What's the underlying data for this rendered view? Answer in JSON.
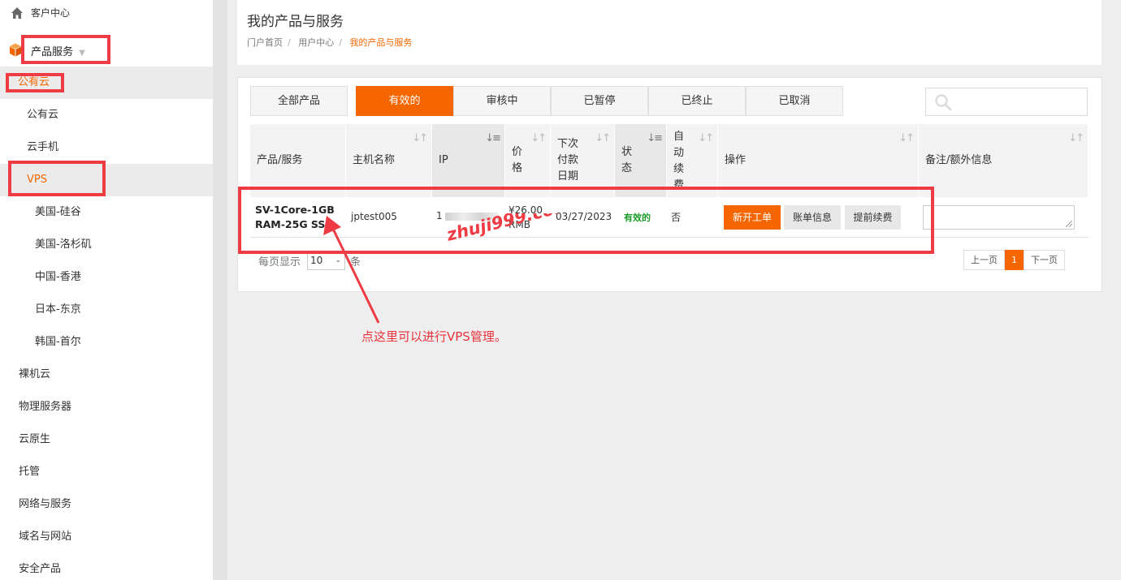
{
  "sidebar": {
    "header": "客户中心",
    "product_menu": "产品服务",
    "public_cloud_group": "公有云",
    "items": [
      {
        "label": "公有云"
      },
      {
        "label": "云手机"
      },
      {
        "label": "VPS"
      },
      {
        "label": "美国-硅谷"
      },
      {
        "label": "美国-洛杉矶"
      },
      {
        "label": "中国-香港"
      },
      {
        "label": "日本-东京"
      },
      {
        "label": "韩国-首尔"
      },
      {
        "label": "裸机云"
      },
      {
        "label": "物理服务器"
      },
      {
        "label": "云原生"
      },
      {
        "label": "托管"
      },
      {
        "label": "网络与服务"
      },
      {
        "label": "域名与网站"
      },
      {
        "label": "安全产品"
      }
    ]
  },
  "header": {
    "title": "我的产品与服务",
    "breadcrumb": [
      "门户首页",
      "用户中心",
      "我的产品与服务"
    ]
  },
  "tabs": [
    "全部产品",
    "有效的",
    "审核中",
    "已暂停",
    "已终止",
    "已取消"
  ],
  "table": {
    "columns": [
      "产品/服务",
      "主机名称",
      "IP",
      "价格",
      "下次付款日期",
      "状态",
      "自动续费",
      "操作",
      "备注/额外信息"
    ],
    "col_price_lines": [
      "价",
      "格"
    ],
    "col_due_lines": [
      "下次",
      "付款",
      "日期"
    ],
    "col_status_lines": [
      "状",
      "态"
    ],
    "col_renew_lines": [
      "自",
      "动",
      "续",
      "费"
    ],
    "row": {
      "product_line1": "SV-1Core-1GB",
      "product_line2": "RAM-25G SSD",
      "hostname": "jptest005",
      "ip": "1",
      "price_line1": "¥26.00",
      "price_line2": "RMB",
      "due_date": "03/27/2023",
      "status": "有效的",
      "auto_renew": "否",
      "actions": [
        "新开工单",
        "账单信息",
        "提前续费"
      ]
    }
  },
  "pager": {
    "per_page_prefix": "每页显示",
    "per_page_value": "10",
    "per_page_suffix": "条",
    "prev": "上一页",
    "current": "1",
    "next": "下一页"
  },
  "annotation": {
    "watermark": "zhuji999.com-主机玖玖",
    "hint": "点这里可以进行VPS管理。"
  },
  "colors": {
    "accent": "#f56600",
    "highlight_red": "#ee3b44",
    "status_green": "#1b9a2a"
  }
}
